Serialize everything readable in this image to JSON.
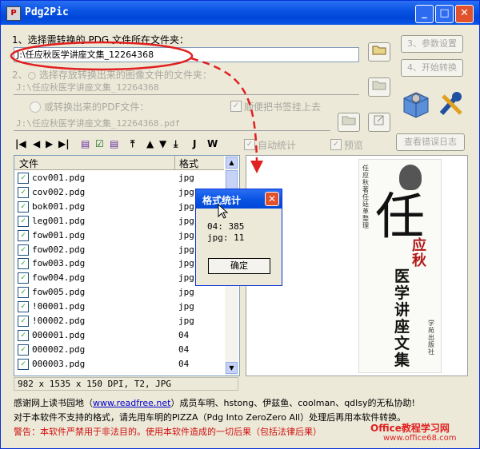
{
  "window": {
    "title": "Pdg2Pic"
  },
  "section1": {
    "label": "1、选择需转换的 PDG 文件所在文件夹：",
    "path": "J:\\任应秋医学讲座文集_12264368"
  },
  "section2": {
    "label": "2、○ 选择存放转换出来的图像文件的文件夹：",
    "path": "J:\\任应秋医学讲座文集_12264368",
    "pdf_option_label": "或转换出来的PDF文件：",
    "pdf_path": "J:\\任应秋医学讲座文集_12264368.pdf",
    "bookmark_label": "顺便把书签挂上去"
  },
  "buttons": {
    "settings": "3、参数设置",
    "start": "4、开始转换",
    "error_log": "查看错误日志"
  },
  "options": {
    "auto_stats": "自动统计",
    "preview": "预览"
  },
  "toolbar": {
    "j_label": "J",
    "w_label": "W"
  },
  "list": {
    "columns": [
      "文件",
      "格式"
    ],
    "rows": [
      {
        "name": "cov001.pdg",
        "format": "jpg"
      },
      {
        "name": "cov002.pdg",
        "format": "jpg"
      },
      {
        "name": "bok001.pdg",
        "format": "jpg"
      },
      {
        "name": "leg001.pdg",
        "format": "jpg"
      },
      {
        "name": "fow001.pdg",
        "format": "jpg"
      },
      {
        "name": "fow002.pdg",
        "format": "jpg"
      },
      {
        "name": "fow003.pdg",
        "format": "jpg"
      },
      {
        "name": "fow004.pdg",
        "format": "jpg"
      },
      {
        "name": "fow005.pdg",
        "format": "jpg"
      },
      {
        "name": "!00001.pdg",
        "format": "jpg"
      },
      {
        "name": "!00002.pdg",
        "format": "jpg"
      },
      {
        "name": "000001.pdg",
        "format": "04"
      },
      {
        "name": "000002.pdg",
        "format": "04"
      },
      {
        "name": "000003.pdg",
        "format": "04"
      }
    ]
  },
  "status_bar": "982 x 1535 x 150 DPI, T2, JPG",
  "notes": {
    "thanks_prefix": "感谢网上读书园地（",
    "thanks_link": "www.readfree.net",
    "thanks_suffix": "）成员车明、hstong、伊兹鱼、coolman、qdlsy的无私协助!",
    "unsupported": "对于本软件不支持的格式，请先用车明的PIZZA（Pdg Into ZeroZero All）处理后再用本软件转换。",
    "warning": "警告：本软件严禁用于非法目的。使用本软件造成的一切后果（包括法律后果）"
  },
  "dialog": {
    "title": "格式统计",
    "line1": "04: 385",
    "line2": "jpg: 11",
    "ok": "确定"
  },
  "preview_cover": {
    "author_line": "任应秋 著  任廷革 整理",
    "title_big": "任",
    "title_red": "应秋",
    "title_rest": "医学讲座文集",
    "publisher": "学苑出版社"
  },
  "watermark": {
    "site": "Office教程学习网",
    "url": "www.office68.com"
  },
  "colors": {
    "title_blue": "#0a55e4",
    "highlight_red": "#e02020",
    "link_blue": "#0000cc"
  },
  "icons": [
    "down-arrow-icon",
    "first-icon",
    "prev-icon",
    "next-icon",
    "last-icon",
    "folder-icon",
    "export-icon",
    "settings-wrench-icon",
    "gear-box-icon"
  ]
}
